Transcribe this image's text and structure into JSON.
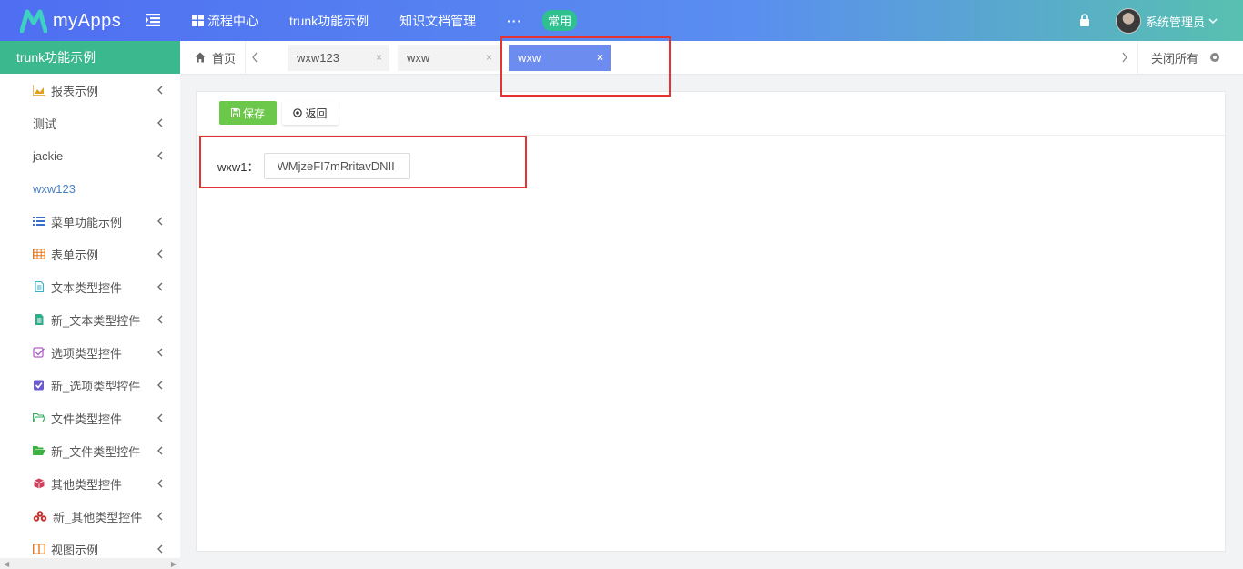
{
  "header": {
    "app_name": "myApps",
    "nav": [
      {
        "label": "流程中心"
      },
      {
        "label": "trunk功能示例"
      },
      {
        "label": "知识文档管理"
      }
    ],
    "more": "···",
    "badge": "常用",
    "user_name": "系统管理员"
  },
  "sidebar": {
    "title": "trunk功能示例",
    "items": [
      {
        "label": "报表示例",
        "icon": "area-chart-icon",
        "color": "#e0a020"
      },
      {
        "label": "测试",
        "icon": "",
        "color": ""
      },
      {
        "label": "jackie",
        "icon": "",
        "color": ""
      },
      {
        "label": "wxw123",
        "icon": "",
        "color": ""
      },
      {
        "label": "菜单功能示例",
        "icon": "list-icon",
        "color": "#3a6fc8"
      },
      {
        "label": "表单示例",
        "icon": "table-icon",
        "color": "#e07820"
      },
      {
        "label": "文本类型控件",
        "icon": "file-text-icon",
        "color": "#3ab0c8"
      },
      {
        "label": "新_文本类型控件",
        "icon": "file-filled-icon",
        "color": "#2fae8c"
      },
      {
        "label": "选项类型控件",
        "icon": "checkbox-outline-icon",
        "color": "#b060c8"
      },
      {
        "label": "新_选项类型控件",
        "icon": "checkbox-filled-icon",
        "color": "#6a5ad0"
      },
      {
        "label": "文件类型控件",
        "icon": "folder-open-icon",
        "color": "#2fae5c"
      },
      {
        "label": "新_文件类型控件",
        "icon": "folder-filled-icon",
        "color": "#3cb040"
      },
      {
        "label": "其他类型控件",
        "icon": "cube-icon",
        "color": "#d0405a"
      },
      {
        "label": "新_其他类型控件",
        "icon": "cubes-icon",
        "color": "#c83030"
      },
      {
        "label": "视图示例",
        "icon": "columns-icon",
        "color": "#e07820"
      }
    ]
  },
  "tabs": {
    "home_label": "首页",
    "items": [
      {
        "label": "wxw123",
        "close": "×"
      },
      {
        "label": "wxw",
        "close": "×"
      },
      {
        "label": "wxw",
        "close": "×"
      }
    ],
    "close_all": "关闭所有"
  },
  "form": {
    "save_label": "保存",
    "back_label": "返回",
    "field_label": "wxw1：",
    "field_value": "WMjzeFI7mRritavDNII"
  },
  "colors": {
    "accent": "#3cb88f",
    "active_tab": "#6d8cef",
    "save_button": "#6cc84a",
    "highlight": "#e53333"
  }
}
